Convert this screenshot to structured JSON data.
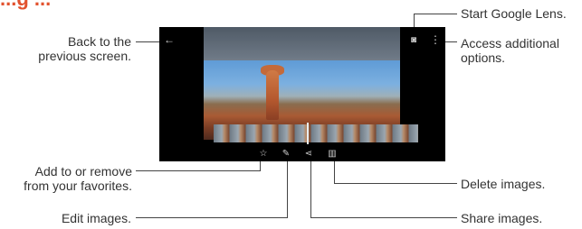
{
  "header": {
    "title_fragment": "...g ..."
  },
  "toolbar_top": {
    "back_icon": "arrow-left-icon",
    "lens_icon": "google-lens-icon",
    "more_icon": "more-vertical-icon"
  },
  "toolbar_bottom": {
    "favorite_icon": "star-icon",
    "edit_icon": "pencil-icon",
    "share_icon": "share-icon",
    "delete_icon": "trash-icon"
  },
  "callouts": {
    "back": "Back to the\nprevious screen.",
    "lens": "Start Google Lens.",
    "more": "Access additional\noptions.",
    "favorite": "Add to or remove\nfrom your favorites.",
    "edit": "Edit images.",
    "delete": "Delete images.",
    "share": "Share images."
  },
  "colors": {
    "accent": "#e2522e",
    "device": "#000000"
  }
}
